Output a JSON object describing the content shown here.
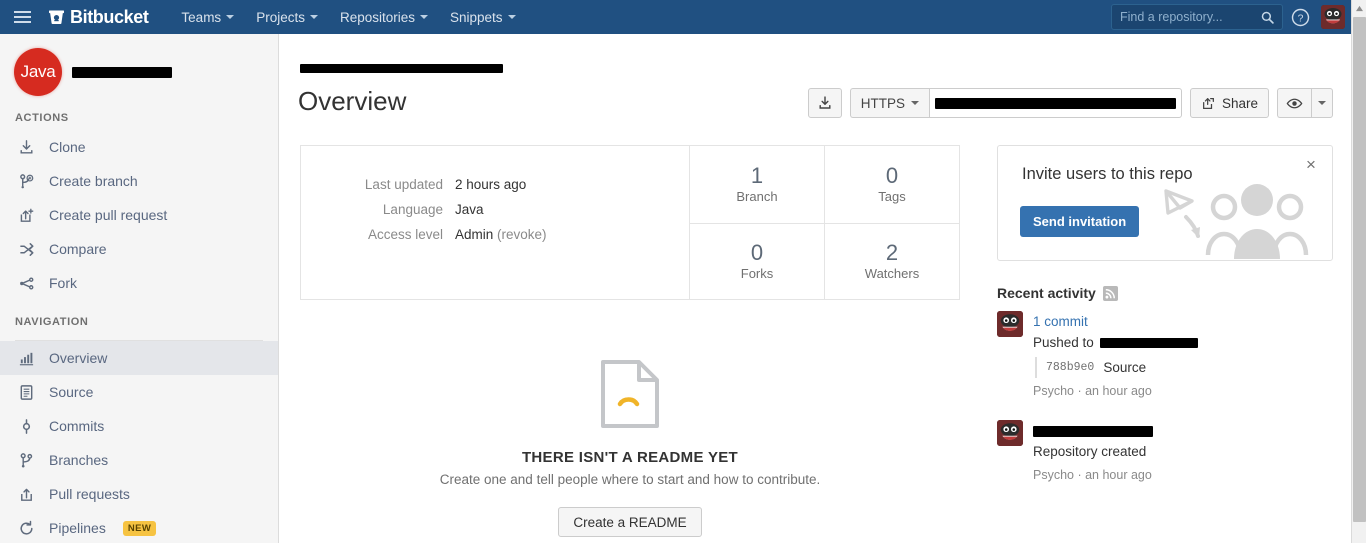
{
  "header": {
    "brand": "Bitbucket",
    "menu": [
      {
        "label": "Teams"
      },
      {
        "label": "Projects"
      },
      {
        "label": "Repositories"
      },
      {
        "label": "Snippets"
      }
    ],
    "search_placeholder": "Find a repository...",
    "search_value": "",
    "help_label": "?",
    "bg_color": "#205081"
  },
  "sidebar": {
    "repo_avatar_text": "Java",
    "repo_name_redacted": "",
    "actions_label": "ACTIONS",
    "actions": [
      {
        "label": "Clone",
        "icon": "download-icon"
      },
      {
        "label": "Create branch",
        "icon": "branch-icon"
      },
      {
        "label": "Create pull request",
        "icon": "pull-request-icon"
      },
      {
        "label": "Compare",
        "icon": "compare-icon"
      },
      {
        "label": "Fork",
        "icon": "fork-icon"
      }
    ],
    "navigation_label": "NAVIGATION",
    "navigation": [
      {
        "label": "Overview",
        "icon": "chart-icon",
        "active": true,
        "badge": ""
      },
      {
        "label": "Source",
        "icon": "file-icon",
        "active": false,
        "badge": ""
      },
      {
        "label": "Commits",
        "icon": "commit-icon",
        "active": false,
        "badge": ""
      },
      {
        "label": "Branches",
        "icon": "branch-icon",
        "active": false,
        "badge": ""
      },
      {
        "label": "Pull requests",
        "icon": "pull-request-icon",
        "active": false,
        "badge": ""
      },
      {
        "label": "Pipelines",
        "icon": "pipelines-icon",
        "active": false,
        "badge": "NEW"
      }
    ]
  },
  "main": {
    "breadcrumb_redacted": "",
    "page_title": "Overview",
    "download_button_title": "Download",
    "clone_protocol": "HTTPS",
    "clone_url_redacted": "",
    "share_label": "Share",
    "watch_label": "Watch",
    "info": {
      "rows": [
        {
          "key": "Last updated",
          "value": "2 hours ago",
          "extra": ""
        },
        {
          "key": "Language",
          "value": "Java",
          "extra": ""
        },
        {
          "key": "Access level",
          "value": "Admin",
          "extra": "(revoke)"
        }
      ],
      "stats": [
        {
          "num": "1",
          "label": "Branch"
        },
        {
          "num": "0",
          "label": "Tags"
        },
        {
          "num": "0",
          "label": "Forks"
        },
        {
          "num": "2",
          "label": "Watchers"
        }
      ]
    },
    "readme": {
      "title": "THERE ISN'T A README YET",
      "subtitle": "Create one and tell people where to start and how to contribute.",
      "button": "Create a README"
    }
  },
  "rail": {
    "invite": {
      "title": "Invite users to this repo",
      "button": "Send invitation",
      "close": "×",
      "button_color": "#3572b0"
    },
    "activity_heading": "Recent activity",
    "activities": [
      {
        "link": "1 commit",
        "line": "Pushed to",
        "redacted": true,
        "commit_hash": "788b9e0",
        "commit_link": "Source",
        "meta": "Psycho · an hour ago"
      },
      {
        "link": "",
        "line": "Repository created",
        "redacted": true,
        "commit_hash": "",
        "commit_link": "",
        "meta": "Psycho · an hour ago"
      }
    ]
  }
}
